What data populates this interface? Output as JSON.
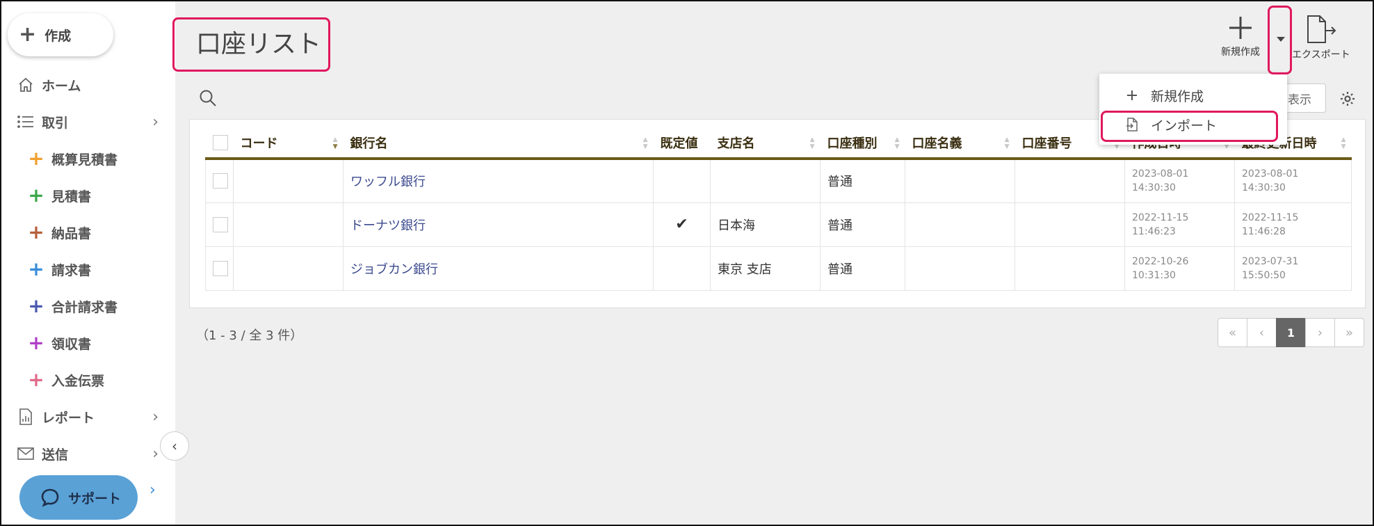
{
  "sidebar": {
    "create_label": "作成",
    "nav": [
      {
        "label": "ホーム",
        "icon": "home-icon"
      },
      {
        "label": "取引",
        "icon": "list-icon"
      }
    ],
    "sub_items": [
      {
        "label": "概算見積書",
        "color": "#f0a030"
      },
      {
        "label": "見積書",
        "color": "#3aa84a"
      },
      {
        "label": "納品書",
        "color": "#b5603a"
      },
      {
        "label": "請求書",
        "color": "#3a8ed8"
      },
      {
        "label": "合計請求書",
        "color": "#4a5ab0"
      },
      {
        "label": "領収書",
        "color": "#b040c8"
      },
      {
        "label": "入金伝票",
        "color": "#e06a8a"
      }
    ],
    "nav_bottom": [
      {
        "label": "レポート",
        "icon": "report-icon"
      },
      {
        "label": "送信",
        "icon": "mail-icon"
      }
    ],
    "support_label": "サポート",
    "collapse_glyph": "‹",
    "chevron_glyph": "›"
  },
  "header": {
    "title": "口座リスト",
    "new_label": "新規作成",
    "export_label": "エクスポート",
    "display_label": "表示"
  },
  "dropdown": {
    "items": [
      {
        "label": "新規作成",
        "icon": "plus-icon"
      },
      {
        "label": "インポート",
        "icon": "import-file-icon"
      }
    ]
  },
  "table": {
    "columns": [
      "コード",
      "銀行名",
      "既定値",
      "支店名",
      "口座種別",
      "口座名義",
      "口座番号",
      "作成日時",
      "最終更新日時"
    ],
    "rows": [
      {
        "code": "",
        "bank": "ワッフル銀行",
        "default": "",
        "branch": "",
        "type": "普通",
        "holder": "",
        "number": "",
        "created": [
          "2023-08-01",
          "14:30:30"
        ],
        "updated": [
          "2023-08-01",
          "14:30:30"
        ]
      },
      {
        "code": "",
        "bank": "ドーナツ銀行",
        "default": "✔",
        "branch": "日本海",
        "type": "普通",
        "holder": "",
        "number": "",
        "created": [
          "2022-11-15",
          "11:46:23"
        ],
        "updated": [
          "2022-11-15",
          "11:46:28"
        ]
      },
      {
        "code": "",
        "bank": "ジョブカン銀行",
        "default": "",
        "branch": "東京 支店",
        "type": "普通",
        "holder": "",
        "number": "",
        "created": [
          "2022-10-26",
          "10:31:30"
        ],
        "updated": [
          "2023-07-31",
          "15:50:50"
        ]
      }
    ]
  },
  "record_count": "（1 - 3 / 全 3 件）",
  "pagination": {
    "first": "«",
    "prev": "‹",
    "current": "1",
    "next": "›",
    "last": "»"
  },
  "colors": {
    "highlight": "#e0185e",
    "support": "#5aa1d6",
    "header_rule": "#6b5a17",
    "link": "#3b4a8e"
  }
}
